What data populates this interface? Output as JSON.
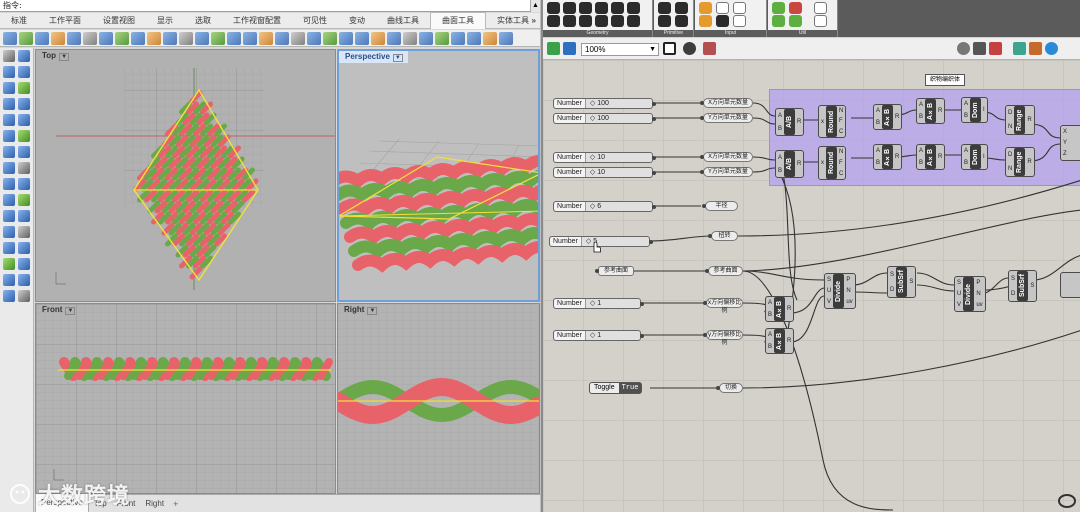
{
  "rhino": {
    "command_prompt": "指令:",
    "menu_tabs": [
      "标准",
      "工作平面",
      "设置视图",
      "显示",
      "选取",
      "工作视窗配置",
      "可见性",
      "变动",
      "曲线工具",
      "曲面工具",
      "实体工具"
    ],
    "menu_more": "»",
    "viewports": {
      "top": "Top",
      "perspective": "Perspective",
      "front": "Front",
      "right": "Right"
    },
    "viewport_tabs": [
      "Perspective",
      "Top",
      "Front",
      "Right"
    ],
    "add_tab": "+",
    "colors": {
      "pink": "#e8626a",
      "green": "#6aa84a",
      "yellow_curve": "#f2e03a",
      "axis_red": "#c84040"
    }
  },
  "watermark": {
    "text": "大数跨境"
  },
  "grasshopper": {
    "ribbon_groups": [
      "Geometry",
      "Primitive",
      "Input",
      "Util"
    ],
    "zoom_value": "100%",
    "group_title": "织物编织体",
    "sliders": [
      {
        "label": "Number",
        "value": "◇ 100"
      },
      {
        "label": "Number",
        "value": "◇ 100"
      },
      {
        "label": "Number",
        "value": "◇ 10"
      },
      {
        "label": "Number",
        "value": "◇ 10"
      },
      {
        "label": "Number",
        "value": "◇ 6"
      },
      {
        "label": "Number",
        "value": "◇ 5"
      },
      {
        "label": "Number",
        "value": "◇ 1"
      },
      {
        "label": "Number",
        "value": "◇ 1"
      }
    ],
    "geometry_param": "参考曲面",
    "panels": [
      "X方向单元数量",
      "Y方向单元数量",
      "X方向单元数量",
      "Y方向单元数量",
      "半径",
      "扭转",
      "参考曲面",
      "x方向偏移比例",
      "y方向偏移比例",
      "切换"
    ],
    "toggle": {
      "label": "Toggle",
      "value": "True"
    },
    "components": {
      "divide_ab": {
        "name": "A/B",
        "inputs": [
          "A",
          "B"
        ],
        "outputs": [
          "R"
        ]
      },
      "round": {
        "name": "Round",
        "inputs": [
          "x"
        ],
        "outputs": [
          "N",
          "F",
          "C"
        ]
      },
      "mult": {
        "name": "A×B",
        "inputs": [
          "A",
          "B"
        ],
        "outputs": [
          "R"
        ]
      },
      "dom": {
        "name": "Dom",
        "inputs": [
          "A",
          "B"
        ],
        "outputs": [
          "I"
        ]
      },
      "range": {
        "name": "Range",
        "inputs": [
          "D",
          "N"
        ],
        "outputs": [
          "R"
        ]
      },
      "divide": {
        "name": "Divide",
        "inputs": [
          "S",
          "U",
          "V"
        ],
        "outputs": [
          "P",
          "N",
          "uv"
        ]
      },
      "subsrf": {
        "name": "SubSrf",
        "inputs": [
          "S",
          "D"
        ],
        "outputs": [
          "S"
        ]
      }
    }
  }
}
